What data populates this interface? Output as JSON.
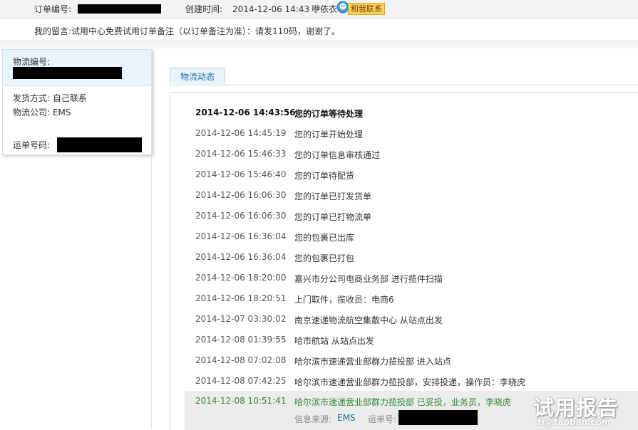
{
  "order": {
    "number_label": "订单编号:",
    "created_label": "创建时间:",
    "created_time": "2014-12-06 14:43",
    "seller_name": "咿依衣",
    "contact_button": "和我联系",
    "message_label": "我的留言:",
    "message_text": "试用中心免费试用订单备注（以订单备注为准）：请发110码，谢谢了。"
  },
  "shipment": {
    "logistics_no_label": "物流编号:",
    "ship_method_label": "发货方式:",
    "ship_method_value": "自己联系",
    "company_label": "物流公司:",
    "company_value": "EMS",
    "waybill_label": "运单号码:"
  },
  "tabs": [
    {
      "label": "物流动态"
    }
  ],
  "tracking": [
    {
      "time": "2014-12-06 14:43:56",
      "event": "您的订单等待处理"
    },
    {
      "time": "2014-12-06 14:45:19",
      "event": "您的订单开始处理"
    },
    {
      "time": "2014-12-06 15:46:33",
      "event": "您的订单信息审核通过"
    },
    {
      "time": "2014-12-06 15:46:40",
      "event": "您的订单待配货"
    },
    {
      "time": "2014-12-06 16:06:30",
      "event": "您的订单已打发货单"
    },
    {
      "time": "2014-12-06 16:06:30",
      "event": "您的订单已打物流单"
    },
    {
      "time": "2014-12-06 16:36:04",
      "event": "您的包裹已出库"
    },
    {
      "time": "2014-12-06 16:36:04",
      "event": "您的包裹已打包"
    },
    {
      "time": "2014-12-06 18:20:00",
      "event": "嘉兴市分公司电商业务部 进行揽件扫描"
    },
    {
      "time": "2014-12-06 18:20:51",
      "event": "上门取件，揽收员：电商6"
    },
    {
      "time": "2014-12-07 03:30:02",
      "event": "南京速递物流航空集散中心 从站点出发"
    },
    {
      "time": "2014-12-08 01:39:55",
      "event": "哈市航站 从站点出发"
    },
    {
      "time": "2014-12-08 07:02:08",
      "event": "哈尔滨市速递营业部群力揽投部 进入站点"
    },
    {
      "time": "2014-12-08 07:42:25",
      "event": "哈尔滨市速递营业部群力揽投部，安排投递，操作员：李晓虎"
    }
  ],
  "latest": {
    "time": "2014-12-08 10:51:41",
    "event": "哈尔滨市速递营业部群力揽投部 已妥投，业务员，李晓虎",
    "source_label": "信息来源:",
    "source_value": "EMS",
    "waybill_label": "运单号:"
  },
  "watermark": {
    "main": "试用报告",
    "url": "try.taobao.com"
  },
  "colors": {
    "latest_text": "#2f8a2f",
    "link": "#1a6fa6",
    "tab_bg": "#eaf4fb",
    "panel_bg": "#e8f3fb"
  }
}
